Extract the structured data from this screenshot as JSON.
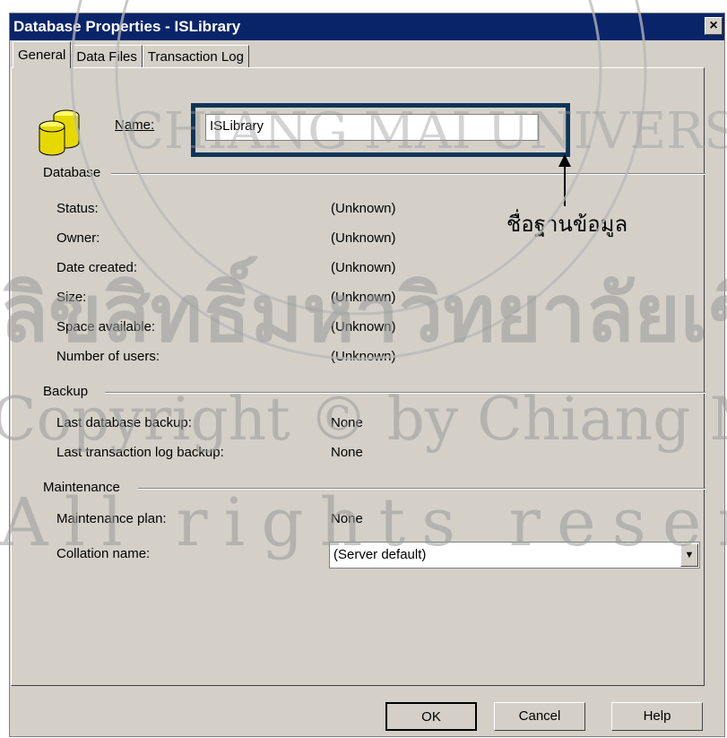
{
  "window": {
    "title": "Database Properties - ISLibrary",
    "close_glyph": "×"
  },
  "tabs": [
    {
      "label": "General",
      "active": true
    },
    {
      "label": "Data Files",
      "active": false
    },
    {
      "label": "Transaction Log",
      "active": false
    }
  ],
  "name_label": "Name:",
  "name_value": "ISLibrary",
  "database": {
    "group_label": "Database",
    "rows": [
      {
        "label": "Status:",
        "value": "(Unknown)"
      },
      {
        "label": "Owner:",
        "value": "(Unknown)"
      },
      {
        "label": "Date created:",
        "value": "(Unknown)"
      },
      {
        "label": "Size:",
        "value": "(Unknown)"
      },
      {
        "label": "Space available:",
        "value": "(Unknown)"
      },
      {
        "label": "Number of users:",
        "value": "(Unknown)"
      }
    ]
  },
  "backup": {
    "group_label": "Backup",
    "rows": [
      {
        "label": "Last database backup:",
        "value": "None"
      },
      {
        "label": "Last transaction log backup:",
        "value": "None"
      }
    ]
  },
  "maintenance": {
    "group_label": "Maintenance",
    "plan_label": "Maintenance plan:",
    "plan_value": "None",
    "collation_label": "Collation name:",
    "collation_value": "(Server default)"
  },
  "buttons": {
    "ok": "OK",
    "cancel": "Cancel",
    "help": "Help"
  },
  "annotation": {
    "text": "ชื่อฐานข้อมูล"
  },
  "watermark": {
    "text_thai": "ลิขสิทธิ์มหาวิทยาลัยเชียงใหม่",
    "text_copyright": "Copyright © by Chiang Mai University",
    "text_rights": "All rights reserved",
    "text_seal": "CHIANG MAI UNIVERSITY"
  },
  "colors": {
    "titlebar": "#0a246a",
    "dialog": "#d4d0c8",
    "highlight_box": "#0c3558"
  }
}
